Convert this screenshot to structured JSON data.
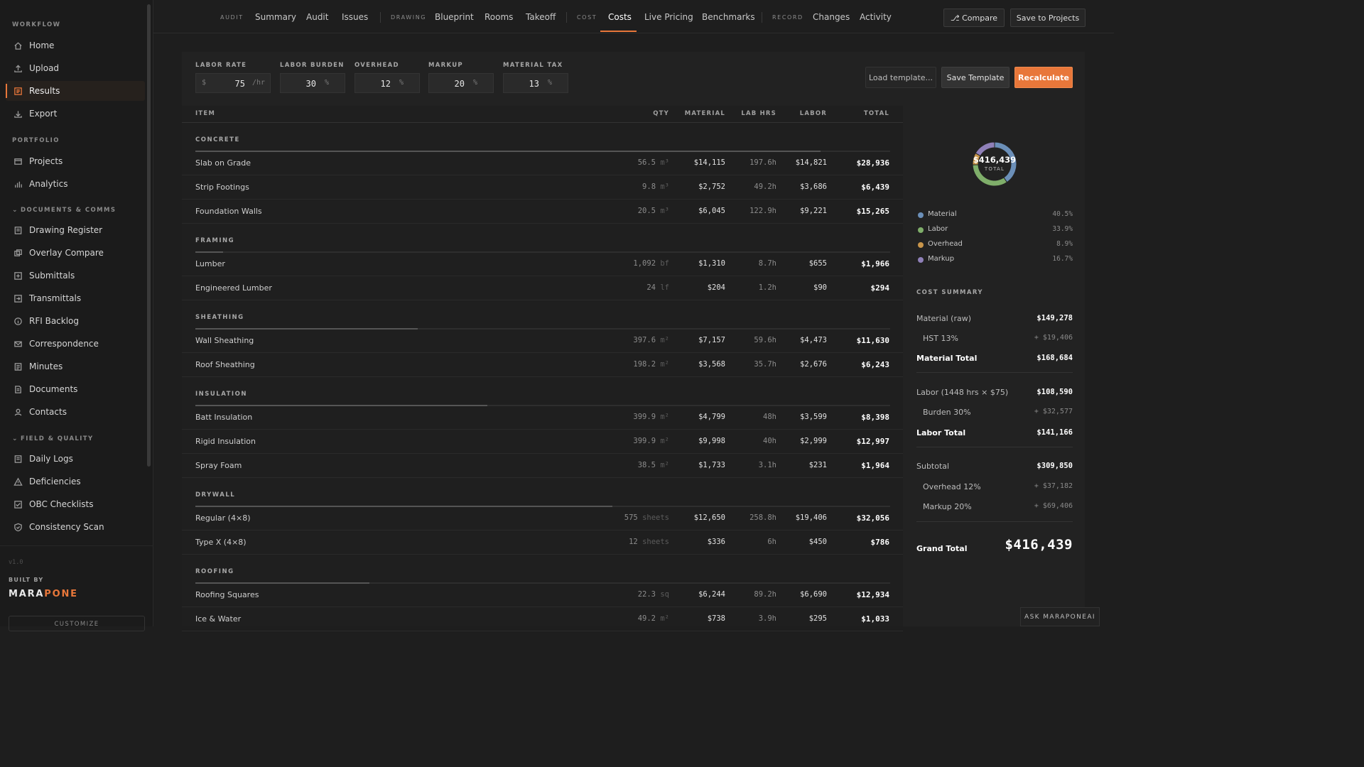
{
  "sidebar": {
    "sections": {
      "workflow": "WORKFLOW",
      "portfolio": "PORTFOLIO",
      "documents": "DOCUMENTS & COMMS",
      "field": "FIELD & QUALITY"
    },
    "items": {
      "home": "Home",
      "upload": "Upload",
      "results": "Results",
      "export": "Export",
      "projects": "Projects",
      "analytics": "Analytics",
      "drawing_register": "Drawing Register",
      "overlay_compare": "Overlay Compare",
      "submittals": "Submittals",
      "transmittals": "Transmittals",
      "rfi_backlog": "RFI Backlog",
      "correspondence": "Correspondence",
      "minutes": "Minutes",
      "documents": "Documents",
      "contacts": "Contacts",
      "daily_logs": "Daily Logs",
      "deficiencies": "Deficiencies",
      "obc_checklists": "OBC Checklists",
      "consistency_scan": "Consistency Scan"
    },
    "active": "Results",
    "version": "v1.0",
    "built_by": "BUILT BY",
    "brand_a": "MARA",
    "brand_b": "PONE",
    "customize": "CUSTOMIZE"
  },
  "topnav": {
    "groups": {
      "audit": "AUDIT",
      "drawing": "DRAWING",
      "cost": "COST",
      "record": "RECORD"
    },
    "tabs": {
      "summary": "Summary",
      "audit": "Audit",
      "issues": "Issues",
      "blueprint": "Blueprint",
      "rooms": "Rooms",
      "takeoff": "Takeoff",
      "costs": "Costs",
      "live_pricing": "Live Pricing",
      "benchmarks": "Benchmarks",
      "changes": "Changes",
      "activity": "Activity"
    },
    "active_tab": "Costs",
    "compare": "⎇ Compare",
    "save_projects": "Save to Projects"
  },
  "params": {
    "labor_rate": {
      "label": "LABOR RATE",
      "prefix": "$",
      "value": "75",
      "suffix": "/hr"
    },
    "labor_burden": {
      "label": "LABOR BURDEN",
      "value": "30",
      "suffix": "%"
    },
    "overhead": {
      "label": "OVERHEAD",
      "value": "12",
      "suffix": "%"
    },
    "markup": {
      "label": "MARKUP",
      "value": "20",
      "suffix": "%"
    },
    "material_tax": {
      "label": "MATERIAL TAX",
      "value": "13",
      "suffix": "%"
    }
  },
  "buttons": {
    "load": "Load template...",
    "save": "Save Template",
    "recalc": "Recalculate"
  },
  "table": {
    "headers": {
      "item": "ITEM",
      "qty": "QTY",
      "material": "MATERIAL",
      "lab_hrs": "LAB HRS",
      "labor": "LABOR",
      "total": "TOTAL"
    },
    "categories": [
      {
        "name": "CONCRETE",
        "share": 0.9,
        "rows": [
          {
            "item": "Slab on Grade",
            "qty": "56.5",
            "unit": "m³",
            "material": "$14,115",
            "hrs": "197.6h",
            "labor": "$14,821",
            "total": "$28,936"
          },
          {
            "item": "Strip Footings",
            "qty": "9.8",
            "unit": "m³",
            "material": "$2,752",
            "hrs": "49.2h",
            "labor": "$3,686",
            "total": "$6,439"
          },
          {
            "item": "Foundation Walls",
            "qty": "20.5",
            "unit": "m³",
            "material": "$6,045",
            "hrs": "122.9h",
            "labor": "$9,221",
            "total": "$15,265"
          }
        ]
      },
      {
        "name": "FRAMING",
        "share": 0.04,
        "rows": [
          {
            "item": "Lumber",
            "qty": "1,092",
            "unit": "bf",
            "material": "$1,310",
            "hrs": "8.7h",
            "labor": "$655",
            "total": "$1,966"
          },
          {
            "item": "Engineered Lumber",
            "qty": "24",
            "unit": "lf",
            "material": "$204",
            "hrs": "1.2h",
            "labor": "$90",
            "total": "$294"
          }
        ]
      },
      {
        "name": "SHEATHING",
        "share": 0.32,
        "rows": [
          {
            "item": "Wall Sheathing",
            "qty": "397.6",
            "unit": "m²",
            "material": "$7,157",
            "hrs": "59.6h",
            "labor": "$4,473",
            "total": "$11,630"
          },
          {
            "item": "Roof Sheathing",
            "qty": "198.2",
            "unit": "m²",
            "material": "$3,568",
            "hrs": "35.7h",
            "labor": "$2,676",
            "total": "$6,243"
          }
        ]
      },
      {
        "name": "INSULATION",
        "share": 0.42,
        "rows": [
          {
            "item": "Batt Insulation",
            "qty": "399.9",
            "unit": "m²",
            "material": "$4,799",
            "hrs": "48h",
            "labor": "$3,599",
            "total": "$8,398"
          },
          {
            "item": "Rigid Insulation",
            "qty": "399.9",
            "unit": "m²",
            "material": "$9,998",
            "hrs": "40h",
            "labor": "$2,999",
            "total": "$12,997"
          },
          {
            "item": "Spray Foam",
            "qty": "38.5",
            "unit": "m²",
            "material": "$1,733",
            "hrs": "3.1h",
            "labor": "$231",
            "total": "$1,964"
          }
        ]
      },
      {
        "name": "DRYWALL",
        "share": 0.6,
        "rows": [
          {
            "item": "Regular (4×8)",
            "qty": "575",
            "unit": "sheets",
            "material": "$12,650",
            "hrs": "258.8h",
            "labor": "$19,406",
            "total": "$32,056"
          },
          {
            "item": "Type X (4×8)",
            "qty": "12",
            "unit": "sheets",
            "material": "$336",
            "hrs": "6h",
            "labor": "$450",
            "total": "$786"
          }
        ]
      },
      {
        "name": "ROOFING",
        "share": 0.25,
        "rows": [
          {
            "item": "Roofing Squares",
            "qty": "22.3",
            "unit": "sq",
            "material": "$6,244",
            "hrs": "89.2h",
            "labor": "$6,690",
            "total": "$12,934"
          },
          {
            "item": "Ice & Water",
            "qty": "49.2",
            "unit": "m²",
            "material": "$738",
            "hrs": "3.9h",
            "labor": "$295",
            "total": "$1,033"
          }
        ]
      }
    ]
  },
  "donut": {
    "total": "$416,439",
    "label": "TOTAL",
    "segments": [
      {
        "name": "Material",
        "pct": "40.5%",
        "value": 40.5,
        "color": "#6b8fb8"
      },
      {
        "name": "Labor",
        "pct": "33.9%",
        "value": 33.9,
        "color": "#7fae6a"
      },
      {
        "name": "Overhead",
        "pct": "8.9%",
        "value": 8.9,
        "color": "#c8954a"
      },
      {
        "name": "Markup",
        "pct": "16.7%",
        "value": 16.7,
        "color": "#8f80b8"
      }
    ]
  },
  "summary": {
    "title": "COST SUMMARY",
    "material_raw": {
      "label": "Material (raw)",
      "value": "$149,278"
    },
    "hst": {
      "label": "HST 13%",
      "value": "+ $19,406"
    },
    "material_total": {
      "label": "Material Total",
      "value": "$168,684"
    },
    "labor": {
      "label": "Labor (1448 hrs × $75)",
      "value": "$108,590"
    },
    "burden": {
      "label": "Burden 30%",
      "value": "+ $32,577"
    },
    "labor_total": {
      "label": "Labor Total",
      "value": "$141,166"
    },
    "subtotal": {
      "label": "Subtotal",
      "value": "$309,850"
    },
    "overhead": {
      "label": "Overhead 12%",
      "value": "+ $37,182"
    },
    "markup": {
      "label": "Markup 20%",
      "value": "+ $69,406"
    },
    "grand": {
      "label": "Grand Total",
      "value": "$416,439"
    }
  },
  "ask": "ASK MARAPONEAI"
}
